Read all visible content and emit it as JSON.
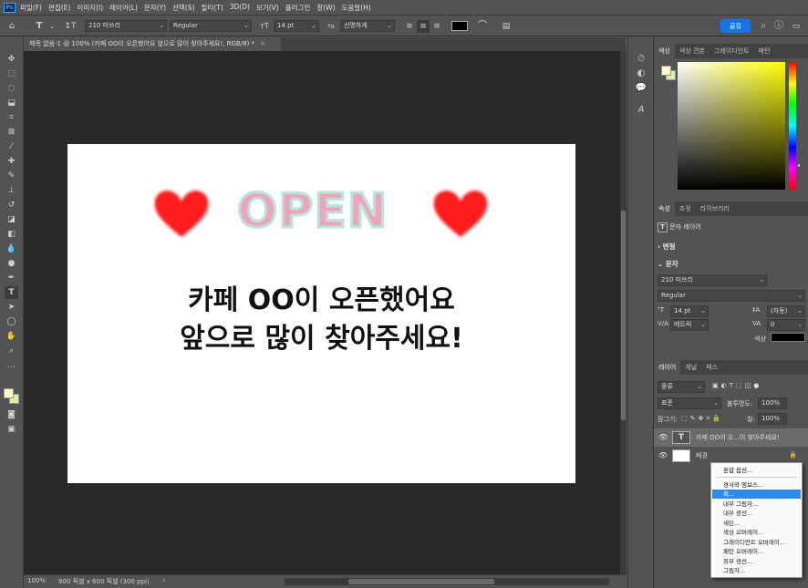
{
  "menubar": {
    "logo": "Ps",
    "items": [
      "파일(F)",
      "편집(E)",
      "이미지(I)",
      "레이어(L)",
      "문자(Y)",
      "선택(S)",
      "필터(T)",
      "3D(D)",
      "보기(V)",
      "플러그인",
      "창(W)",
      "도움말(H)"
    ]
  },
  "options": {
    "font_family": "210 미쓰리",
    "font_style": "Regular",
    "font_size": "14 pt",
    "aa_label": "ªa",
    "antialias": "선명하게",
    "share_label": "공유",
    "text_color": "#000000"
  },
  "document": {
    "tab_title": "제목 없음-1 @ 100% (카페 OO이 오픈했어요 앞으로 많이 찾아주세요!, RGB/8) *",
    "close_icon": "×"
  },
  "canvas": {
    "open_text": "OPEN",
    "line1": "카페 OO이 오픈했어요",
    "line2": "앞으로 많이 찾아주세요!",
    "heart_color": "#ff1a1a",
    "open_fill": "#f0a3c0",
    "open_stroke": "#b7e6d6"
  },
  "status": {
    "zoom": "100%",
    "doc_size": "900 픽셀 x 600 픽셀 (300 ppi)"
  },
  "color_panel": {
    "tabs": [
      "색상",
      "색상 견본",
      "그레이디언트",
      "패턴"
    ]
  },
  "properties_panel": {
    "tabs": [
      "속성",
      "조정",
      "라이브러리"
    ],
    "layer_type": "문자 레이어",
    "transform_label": "변형",
    "char_label": "문자",
    "font_family": "210 미쓰리",
    "font_style": "Regular",
    "size": "14 pt",
    "leading": "(자동)",
    "kerning": "메트릭",
    "tracking": "0",
    "color_label": "색상"
  },
  "layers_panel": {
    "tabs": [
      "레이어",
      "채널",
      "패스"
    ],
    "filter_label": "종류",
    "blend_mode": "표준",
    "opacity_label": "불투명도:",
    "opacity": "100%",
    "lock_label": "잠그기:",
    "fill_label": "칠:",
    "fill": "100%",
    "layers": [
      {
        "name": "카페 OO이 오...이 찾아주세요!",
        "thumb": "T",
        "selected": true
      },
      {
        "name": "배경",
        "thumb": "",
        "selected": false
      }
    ]
  },
  "context_menu": {
    "items": [
      "혼합 옵션...",
      "경사와 엠보스...",
      "획...",
      "내부 그림자...",
      "내부 광선...",
      "새틴...",
      "색상 오버레이...",
      "그레이디언트 오버레이...",
      "패턴 오버레이...",
      "외부 광선...",
      "그림자..."
    ],
    "highlighted": "획..."
  }
}
